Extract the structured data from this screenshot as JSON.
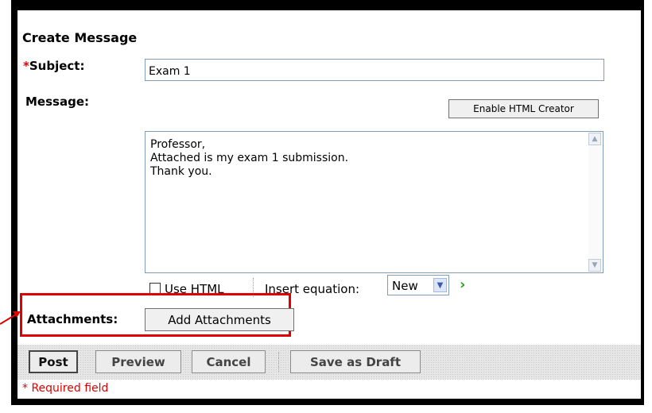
{
  "form": {
    "heading": "Create Message",
    "required_marker": "*",
    "subject_label": "Subject:",
    "subject_value": "Exam 1",
    "message_label": "Message:",
    "enable_html_creator_label": "Enable HTML Creator",
    "message_body": "Professor,\nAttached is my exam 1 submission.\nThank you.",
    "use_html_label": "Use HTML",
    "use_html_checked": false,
    "insert_equation_label": "Insert equation:",
    "insert_equation_selected": "New",
    "attachments_label": "Attachments:",
    "add_attachments_label": "Add Attachments"
  },
  "toolbar": {
    "post_label": "Post",
    "preview_label": "Preview",
    "cancel_label": "Cancel",
    "save_draft_label": "Save as Draft"
  },
  "footer": {
    "required_note": "* Required field"
  },
  "colors": {
    "required": "#e00000",
    "highlight": "#e00000",
    "go_arrow": "#2aa02a"
  },
  "icons": {
    "go": "go-arrow-icon",
    "dropdown": "chevron-down-icon",
    "scroll_up": "scroll-up-icon",
    "scroll_down": "scroll-down-icon"
  }
}
